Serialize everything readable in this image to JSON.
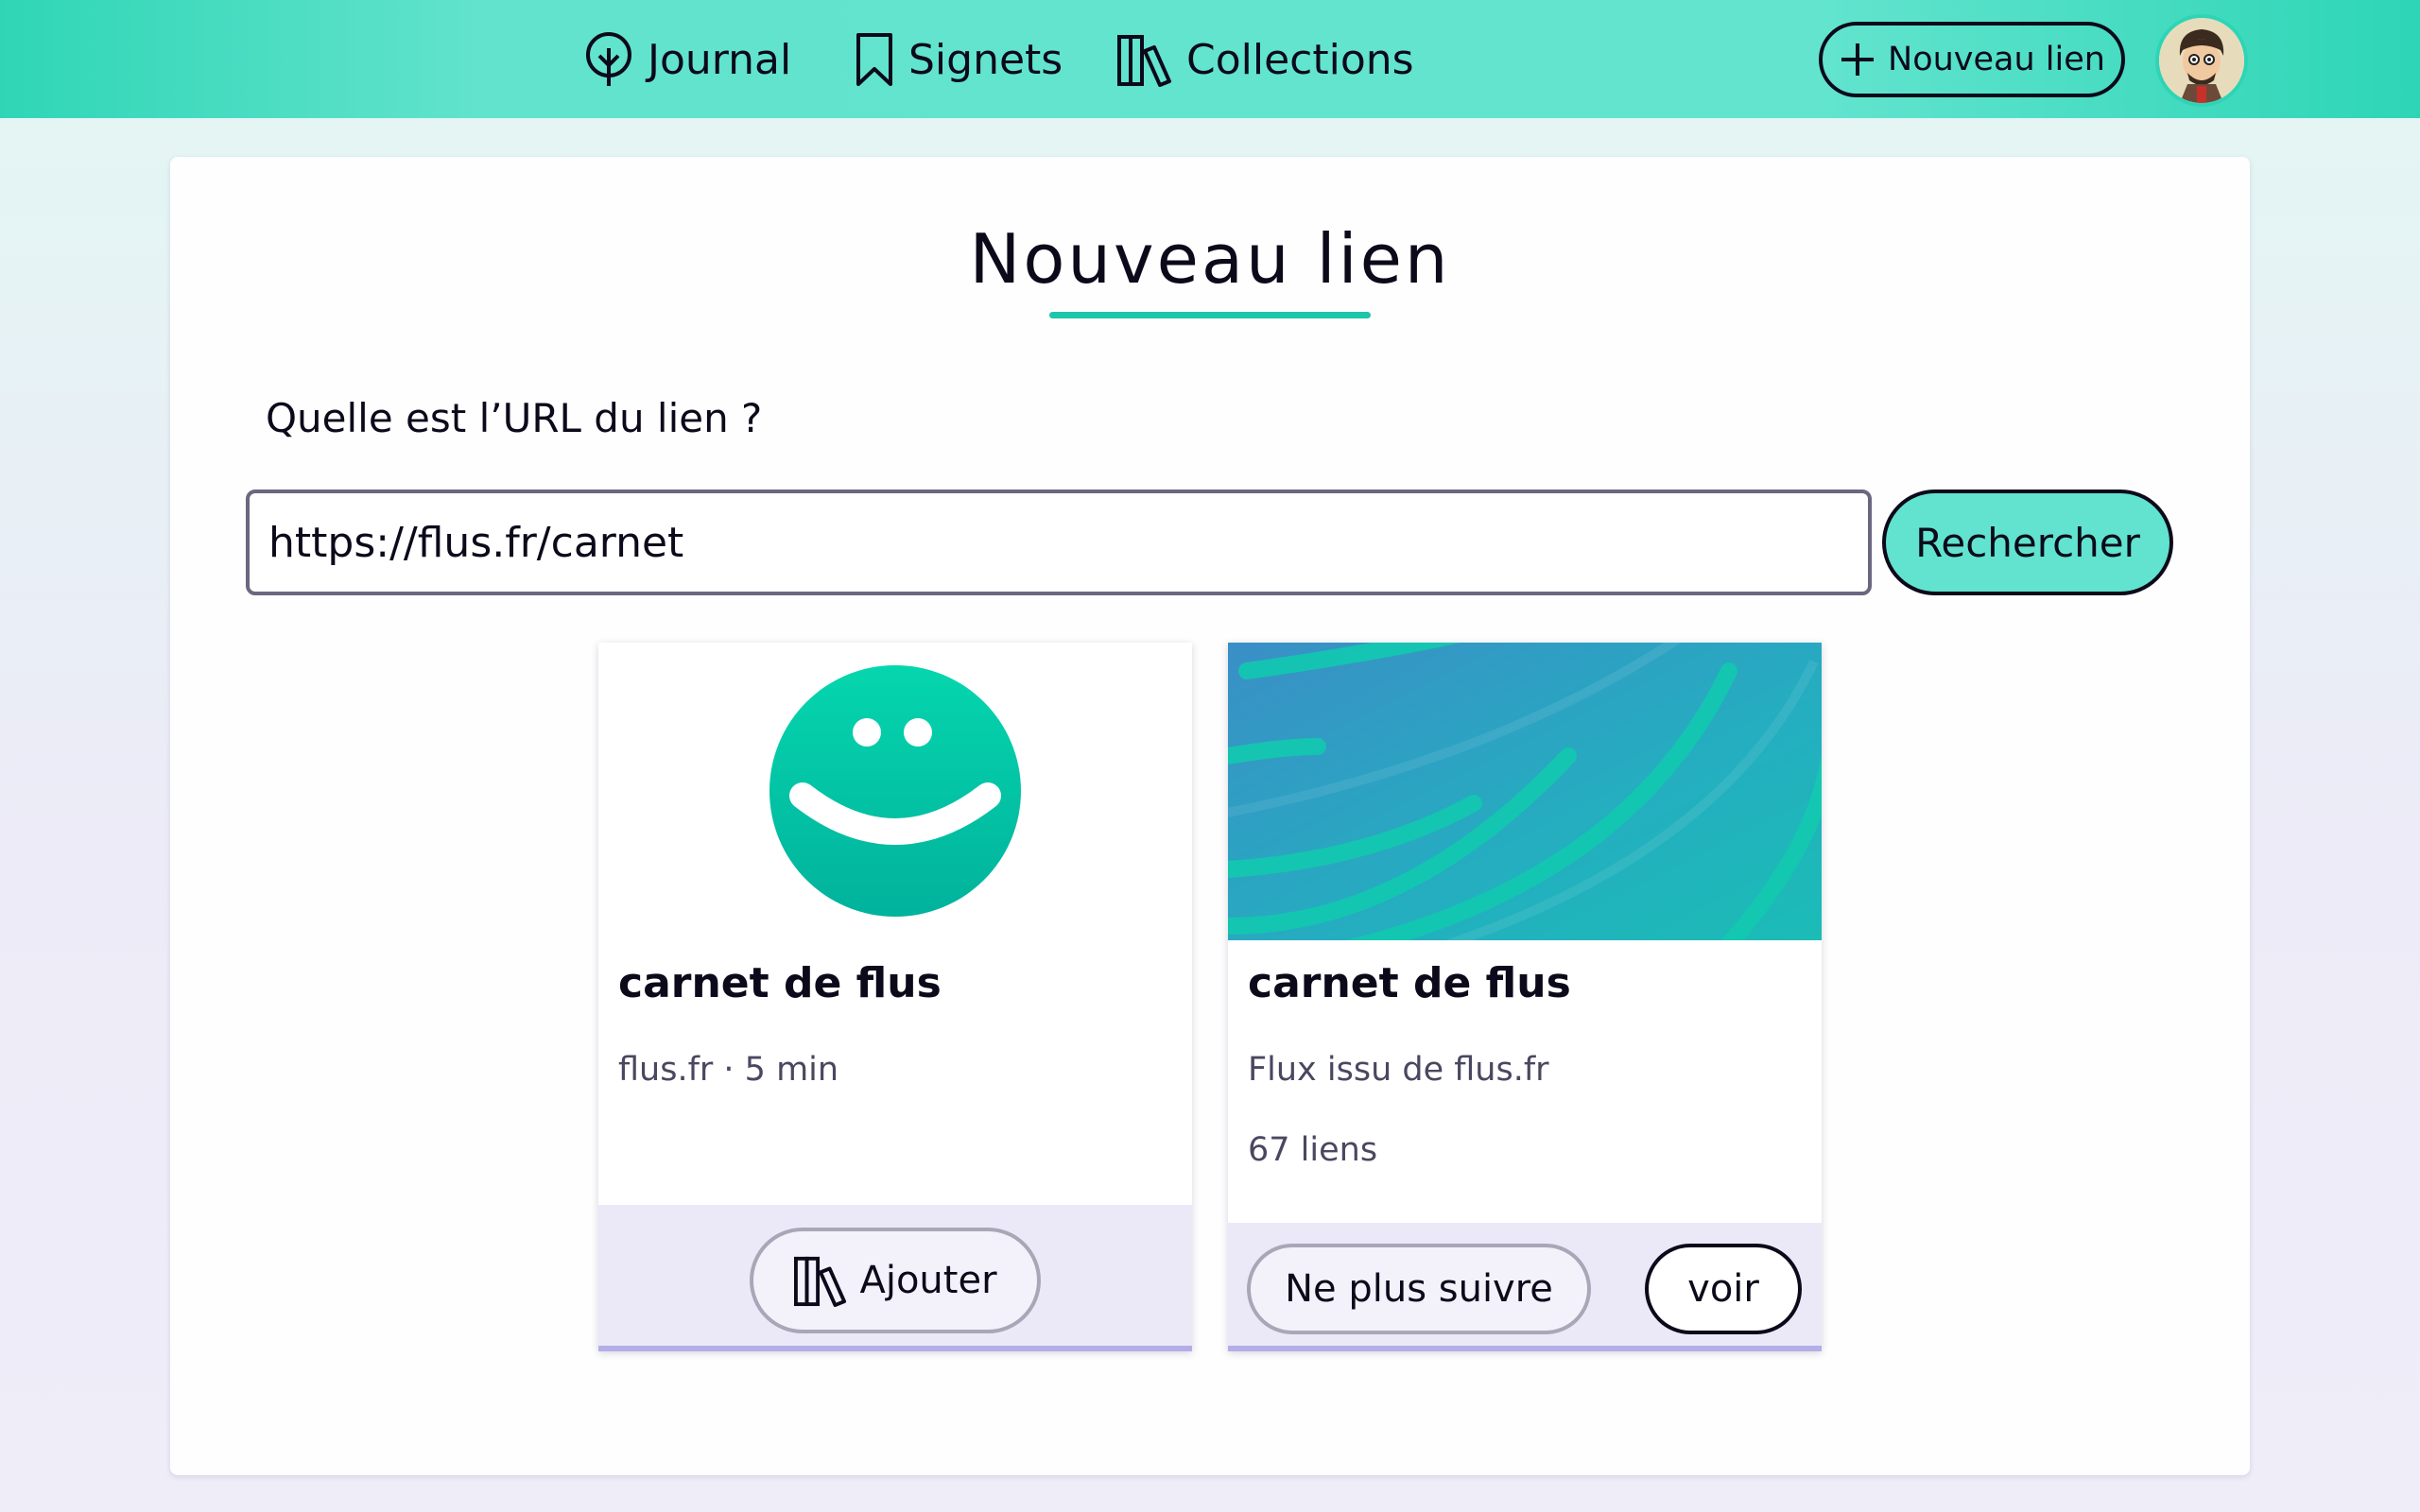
{
  "nav": {
    "journal": "Journal",
    "signets": "Signets",
    "collections": "Collections",
    "new_link_button": "Nouveau lien"
  },
  "page": {
    "title": "Nouveau lien",
    "url_label": "Quelle est l’URL du lien ?",
    "url_value": "https://flus.fr/carnet",
    "search_button": "Rechercher"
  },
  "results": [
    {
      "kind": "link",
      "title": "carnet de flus",
      "meta": "flus.fr · 5 min",
      "action": "Ajouter",
      "action_icon": "collections-icon"
    },
    {
      "kind": "feed",
      "title": "carnet de flus",
      "description": "Flux issu de flus.fr",
      "count": "67 liens",
      "unfollow": "Ne plus suivre",
      "view": "voir"
    }
  ],
  "colors": {
    "accent": "#61e3cf",
    "brand_teal": "#1fc5a8",
    "text": "#0c0a1a"
  }
}
